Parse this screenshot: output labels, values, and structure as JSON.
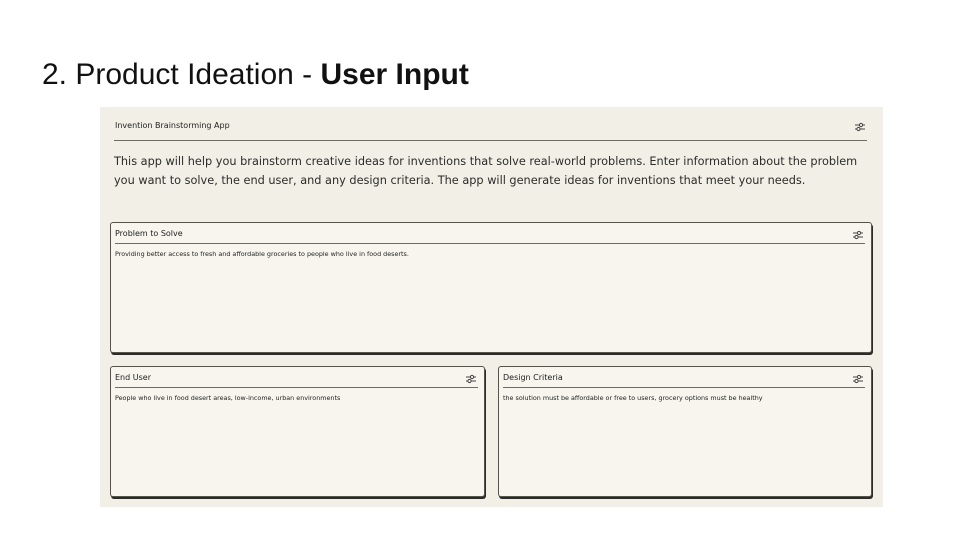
{
  "slide": {
    "title_prefix": "2. Product Ideation - ",
    "title_bold": "User Input"
  },
  "app": {
    "title": "Invention Brainstorming App",
    "description": "This app will help you brainstorm creative ideas for inventions that solve real-world problems. Enter information about the problem you want to solve, the end user, and any design criteria. The app will generate ideas for inventions that meet your needs.",
    "settings_icon": "tune-icon"
  },
  "fields": {
    "problem": {
      "label": "Problem to Solve",
      "value": "Providing better access to fresh and affordable groceries to people who live in food deserts."
    },
    "end_user": {
      "label": "End User",
      "value": "People who live in food desert areas, low-income, urban environments"
    },
    "design_criteria": {
      "label": "Design Criteria",
      "value": "the solution must be affordable or free to users, grocery options must be healthy"
    }
  },
  "colors": {
    "app_background": "#f2f0e6",
    "card_background": "#f7f5ee",
    "border": "#555449"
  }
}
